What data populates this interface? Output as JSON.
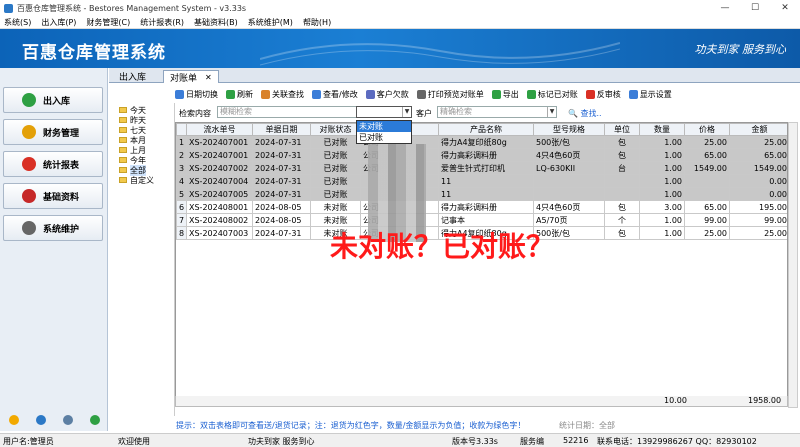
{
  "window": {
    "title": "百惠仓库管理系统 - Bestores Management System - v3.33s"
  },
  "menu": [
    "系统(S)",
    "出入库(P)",
    "财务管理(C)",
    "统计报表(R)",
    "基础资料(B)",
    "系统维护(M)",
    "帮助(H)"
  ],
  "banner": {
    "title": "百惠仓库管理系统",
    "slogan": "功夫到家  服务到心"
  },
  "sidebar": [
    {
      "label": "出入库",
      "icon": "check-icon",
      "color": "#2ea043"
    },
    {
      "label": "财务管理",
      "icon": "star-icon",
      "color": "#e3a008"
    },
    {
      "label": "统计报表",
      "icon": "pie-chart-icon",
      "color": "#d93025"
    },
    {
      "label": "基础资料",
      "icon": "book-icon",
      "color": "#c62828"
    },
    {
      "label": "系统维护",
      "icon": "gear-icon",
      "color": "#666666"
    }
  ],
  "tabs": [
    "出入库",
    "对账单"
  ],
  "toolbar": [
    "日期切换",
    "刷新",
    "关联查找",
    "查看/修改",
    "客户欠款",
    "打印预览对账单",
    "导出",
    "标记已对账",
    "反审核",
    "显示设置"
  ],
  "tree": [
    "今天",
    "昨天",
    "七天",
    "本月",
    "上月",
    "今年",
    "全部",
    "自定义"
  ],
  "filter": {
    "label": "检索内容",
    "placeholder": "模糊检索",
    "customer_label": "客户",
    "customer_placeholder": "精确检索",
    "search": "查找.."
  },
  "status_options": [
    "未对账",
    "已对账"
  ],
  "table": {
    "columns": [
      "流水单号",
      "单据日期",
      "对账状态",
      "客户",
      "产品名称",
      "型号规格",
      "单位",
      "数量",
      "价格",
      "金额"
    ],
    "rows": [
      {
        "n": "1",
        "id": "XS-202407001",
        "date": "2024-07-31",
        "status": "已对账",
        "cust": "公司",
        "name": "得力A4复印纸80g",
        "spec": "500张/包",
        "unit": "包",
        "qty": "1.00",
        "price": "25.00",
        "amt": "25.00",
        "gray": true
      },
      {
        "n": "2",
        "id": "XS-202407001",
        "date": "2024-07-31",
        "status": "已对账",
        "cust": "公司",
        "name": "得力高彩调料册",
        "spec": "4只4色60页",
        "unit": "包",
        "qty": "1.00",
        "price": "65.00",
        "amt": "65.00",
        "gray": true
      },
      {
        "n": "3",
        "id": "XS-202407002",
        "date": "2024-07-31",
        "status": "已对账",
        "cust": "公司",
        "name": "爱普生针式打印机",
        "spec": "LQ-630KII",
        "unit": "台",
        "qty": "1.00",
        "price": "1549.00",
        "amt": "1549.00",
        "gray": true
      },
      {
        "n": "4",
        "id": "XS-202407004",
        "date": "2024-07-31",
        "status": "已对账",
        "cust": "",
        "name": "11",
        "spec": "",
        "unit": "",
        "qty": "1.00",
        "price": "",
        "amt": "0.00",
        "gray": true
      },
      {
        "n": "5",
        "id": "XS-202407005",
        "date": "2024-07-31",
        "status": "已对账",
        "cust": "",
        "name": "11",
        "spec": "",
        "unit": "",
        "qty": "1.00",
        "price": "",
        "amt": "0.00",
        "gray": true
      },
      {
        "n": "6",
        "id": "XS-202408001",
        "date": "2024-08-05",
        "status": "未对账",
        "cust": "公司",
        "name": "得力高彩调料册",
        "spec": "4只4色60页",
        "unit": "包",
        "qty": "3.00",
        "price": "65.00",
        "amt": "195.00",
        "gray": false
      },
      {
        "n": "7",
        "id": "XS-202408002",
        "date": "2024-08-05",
        "status": "未对账",
        "cust": "公司",
        "name": "记事本",
        "spec": "A5/70页",
        "unit": "个",
        "qty": "1.00",
        "price": "99.00",
        "amt": "99.00",
        "gray": false
      },
      {
        "n": "8",
        "id": "XS-202407003",
        "date": "2024-07-31",
        "status": "未对账",
        "cust": "公司",
        "name": "得力A4复印纸80g",
        "spec": "500张/包",
        "unit": "包",
        "qty": "1.00",
        "price": "25.00",
        "amt": "25.00",
        "gray": false
      }
    ],
    "total_qty": "10.00",
    "total_amt": "1958.00"
  },
  "overlay": "未对账？已对账？",
  "tip": "提示：双击表格即可查看送/退货记录；注：退货为红色字，数量/金额显示为负值；收款为绿色字！",
  "tip_date": "统计日期：全部",
  "status": {
    "user": "用户名:管理员",
    "welcome": "欢迎使用",
    "slogan": "功夫到家 服务到心",
    "version": "版本号3.33s",
    "service_label": "服务编",
    "service_no": "52216",
    "contact": "联系电话：13929986267 QQ：82930102"
  },
  "colors": {
    "banner": "#1b7fd4",
    "highlight": "#2b7bd8",
    "overlay": "#ff1a1a",
    "tip": "#1a5fd1"
  }
}
